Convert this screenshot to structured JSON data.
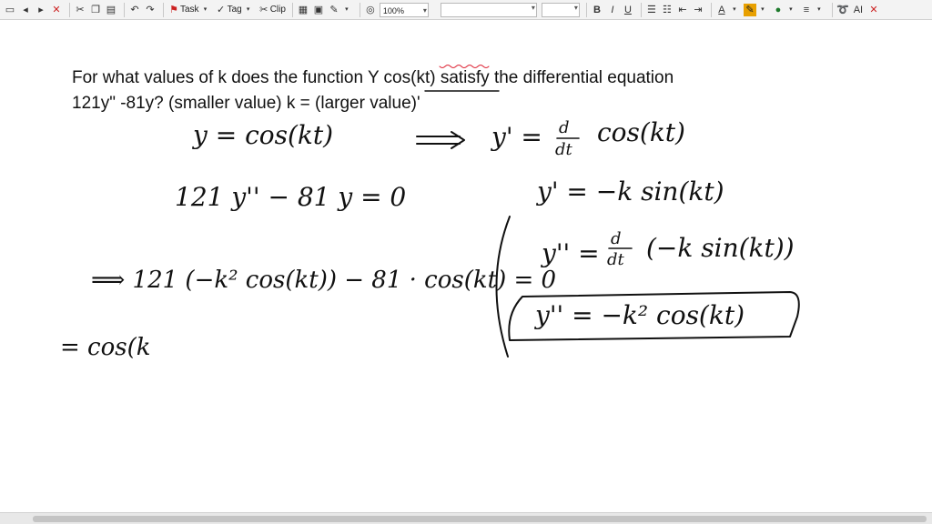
{
  "toolbar": {
    "task_label": "Task",
    "tag_label": "Tag",
    "clip_label": "Clip",
    "zoom_value": "100%",
    "font_value": "",
    "size_value": "",
    "bold_label": "B",
    "italic_label": "I",
    "underline_label": "U"
  },
  "question": {
    "line1": "For what values of k does the function Y cos(kt) satisfy the differential equation",
    "line2": "121y\" -81y? (smaller value) k = (larger value)'"
  },
  "handwriting": {
    "line_a_left": "y = cos(kt)",
    "line_a_arrow": "⟹",
    "line_a_right": "y' = d/dt cos(kt)",
    "line_b_left": "121 y'' − 81 y = 0",
    "line_b_right": "y' = −k sin(kt)",
    "line_c_right": "y'' = d/dt (−k sin(kt))",
    "line_c_left": "⟹ 121 (−k² cos(kt)) − 81 · cos(kt) = 0",
    "boxed": "y'' = −k² cos(kt)",
    "line_d": "= cos(k"
  },
  "colors": {
    "ink": "#111111",
    "highlight": "#e8a000"
  }
}
